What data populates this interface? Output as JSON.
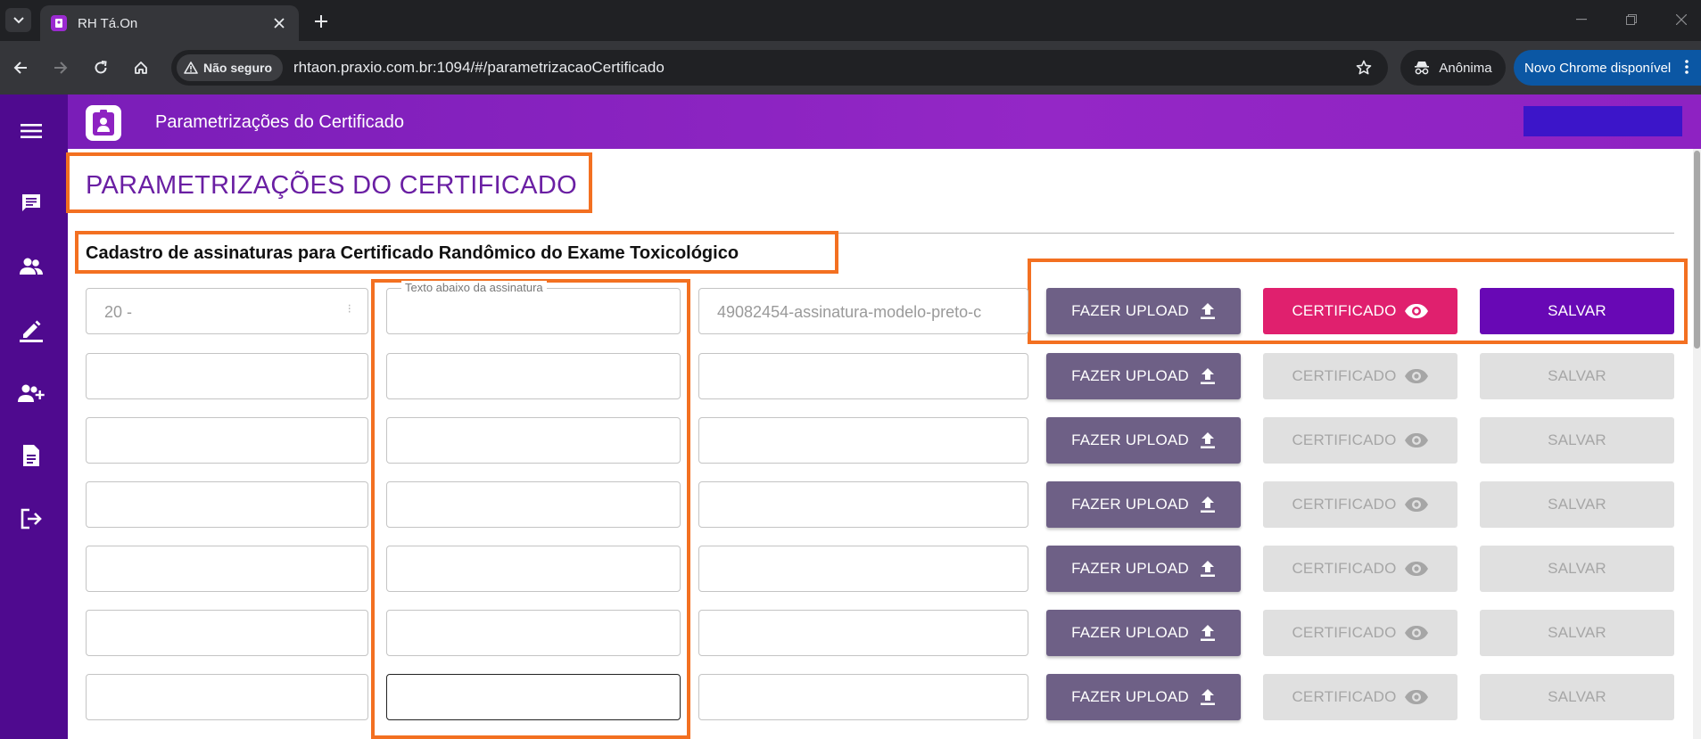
{
  "browser": {
    "tab_title": "RH Tá.On",
    "security_label": "Não seguro",
    "url": "rhtaon.praxio.com.br:1094/#/parametrizacaoCertificado",
    "incognito_label": "Anônima",
    "update_label": "Novo Chrome disponível"
  },
  "appbar": {
    "title": "Parametrizações do Certificado"
  },
  "sidebar": {
    "items": [
      "menu-icon",
      "chat-icon",
      "group-icon",
      "edit-icon",
      "add-user-icon",
      "document-icon",
      "logout-icon"
    ]
  },
  "page": {
    "title": "PARAMETRIZAÇÕES DO CERTIFICADO",
    "section_title": "Cadastro de assinaturas para Certificado Randômico do Exame Toxicológico",
    "text_field_legend": "Texto abaixo da assinatura"
  },
  "rows": [
    {
      "code": "20 -",
      "text": "",
      "file": "49082454-assinatura-modelo-preto-c",
      "upload_label": "FAZER UPLOAD",
      "cert_label": "CERTIFICADO",
      "save_label": "SALVAR",
      "enabled": true
    },
    {
      "code": "",
      "text": "",
      "file": "",
      "upload_label": "FAZER UPLOAD",
      "cert_label": "CERTIFICADO",
      "save_label": "SALVAR",
      "enabled": false
    },
    {
      "code": "",
      "text": "",
      "file": "",
      "upload_label": "FAZER UPLOAD",
      "cert_label": "CERTIFICADO",
      "save_label": "SALVAR",
      "enabled": false
    },
    {
      "code": "",
      "text": "",
      "file": "",
      "upload_label": "FAZER UPLOAD",
      "cert_label": "CERTIFICADO",
      "save_label": "SALVAR",
      "enabled": false
    },
    {
      "code": "",
      "text": "",
      "file": "",
      "upload_label": "FAZER UPLOAD",
      "cert_label": "CERTIFICADO",
      "save_label": "SALVAR",
      "enabled": false
    },
    {
      "code": "",
      "text": "",
      "file": "",
      "upload_label": "FAZER UPLOAD",
      "cert_label": "CERTIFICADO",
      "save_label": "SALVAR",
      "enabled": false
    },
    {
      "code": "",
      "text": "",
      "file": "",
      "upload_label": "FAZER UPLOAD",
      "cert_label": "CERTIFICADO",
      "save_label": "SALVAR",
      "enabled": false
    }
  ],
  "colors": {
    "sidebar": "#4f0a8f",
    "appbar": "#9427c6",
    "title_purple": "#6a1fa3",
    "upload": "#6e6086",
    "certificate": "#e0206e",
    "save": "#6808b5",
    "highlight": "#f37021"
  }
}
